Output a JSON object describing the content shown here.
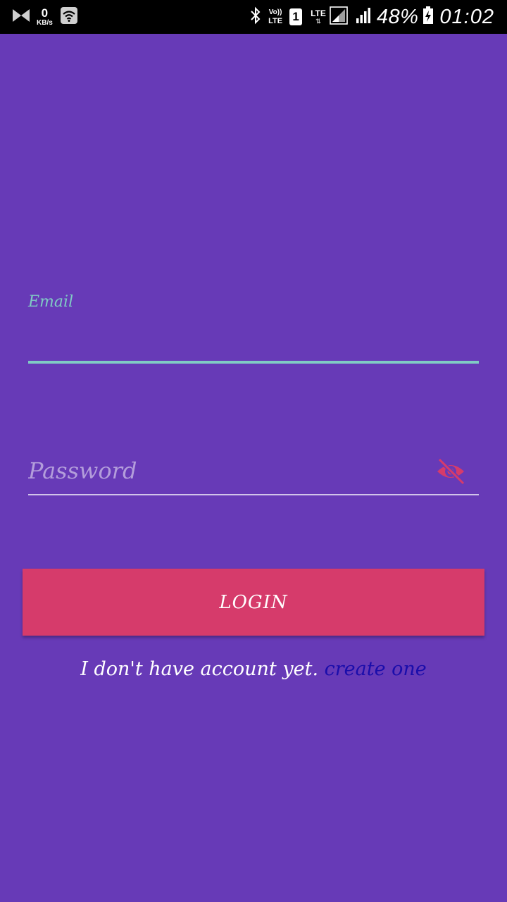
{
  "status_bar": {
    "net_speed_value": "0",
    "net_speed_unit": "KB/s",
    "volte_top": "Vo))",
    "volte_bottom": "LTE",
    "sim_slot": "1",
    "network_type": "LTE",
    "network_arrows": "⇅",
    "battery_percent": "48%",
    "time": "01:02",
    "icons": [
      "app-notification-icon",
      "wifi-icon",
      "bluetooth-icon",
      "signal-icon",
      "battery-icon"
    ]
  },
  "form": {
    "email_label": "Email",
    "email_value": "",
    "password_placeholder": "Password",
    "password_value": "",
    "visibility_icon": "eye-off-icon"
  },
  "login_button": {
    "label": "LOGIN"
  },
  "signup": {
    "text": "I don't have account yet.",
    "link": "create one"
  },
  "colors": {
    "background": "#673ab7",
    "accent_teal": "#80cbc4",
    "button_pink": "#d63b6b",
    "link_blue": "#1a0dab",
    "status_bar": "#000000"
  }
}
